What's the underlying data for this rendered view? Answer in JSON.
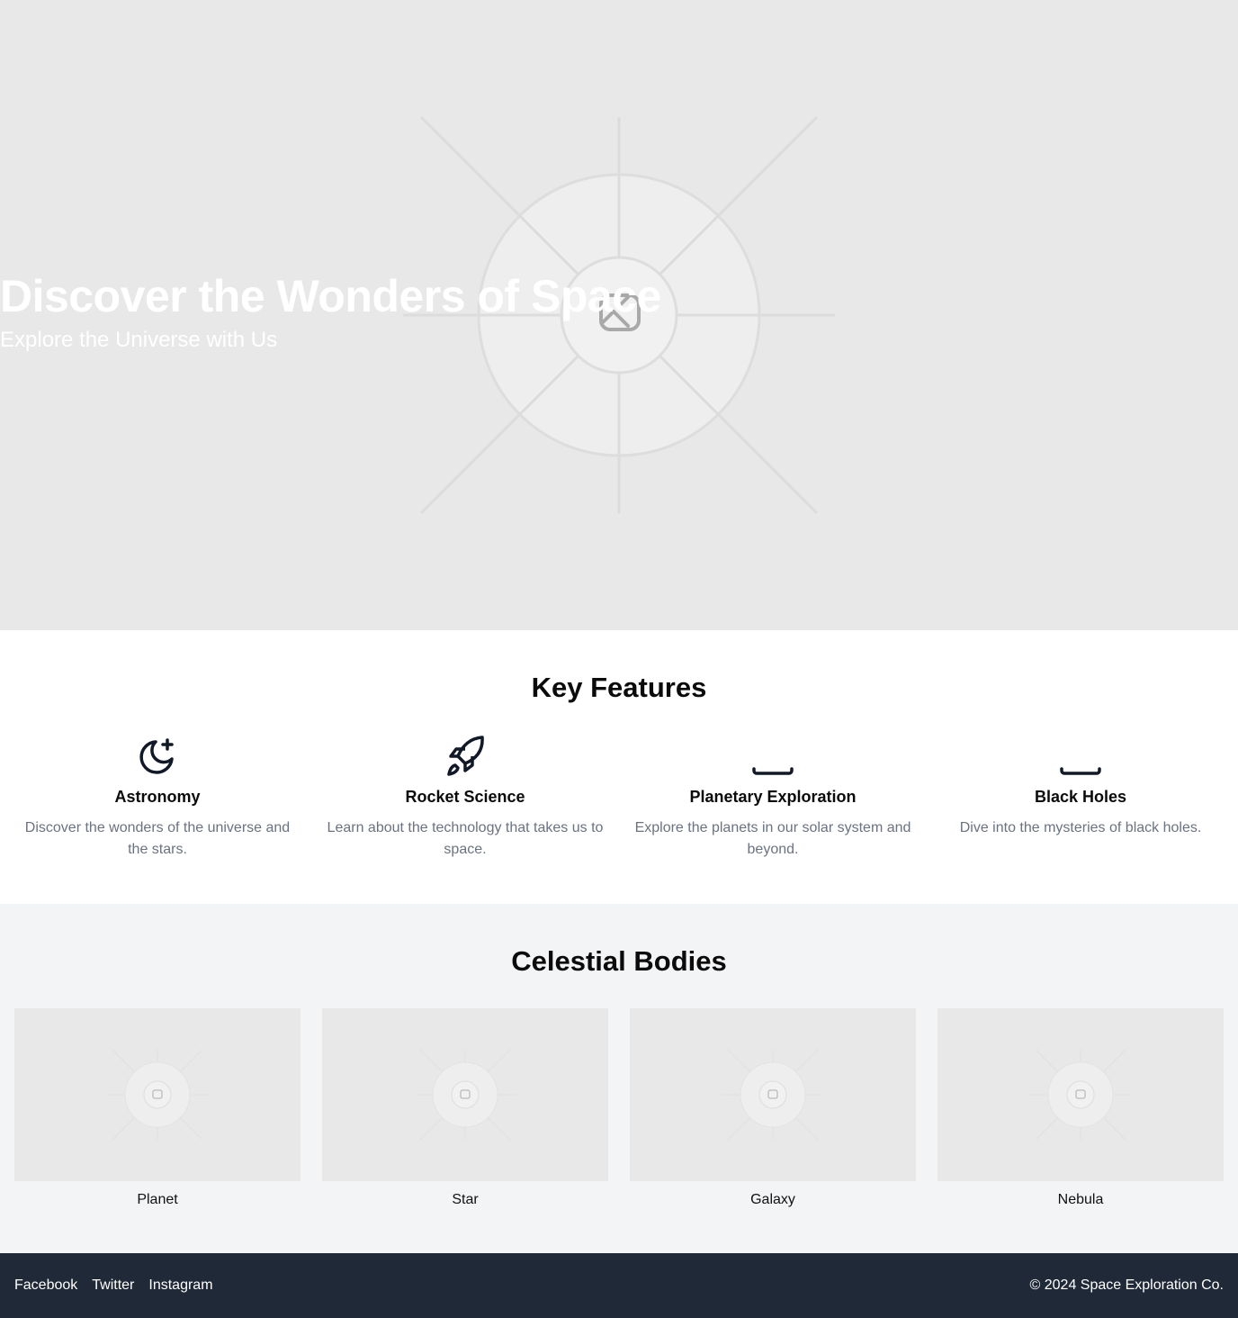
{
  "hero": {
    "title": "Discover the Wonders of Space",
    "subtitle": "Explore the Universe with Us",
    "background_color": "#e8e8e8",
    "image_icon": "image-placeholder-icon"
  },
  "features": {
    "title": "Key Features",
    "items": [
      {
        "icon": "moon-star-icon",
        "title": "Astronomy",
        "description": "Discover the wonders of the universe and the stars."
      },
      {
        "icon": "rocket-icon",
        "title": "Rocket Science",
        "description": "Learn about the technology that takes us to space."
      },
      {
        "icon": "planet-icon",
        "title": "Planetary Exploration",
        "description": "Explore the planets in our solar system and beyond."
      },
      {
        "icon": "black-hole-icon",
        "title": "Black Holes",
        "description": "Dive into the mysteries of black holes."
      }
    ]
  },
  "celestial": {
    "title": "Celestial Bodies",
    "items": [
      {
        "label": "Planet",
        "image_icon": "image-placeholder-icon"
      },
      {
        "label": "Star",
        "image_icon": "image-placeholder-icon"
      },
      {
        "label": "Galaxy",
        "image_icon": "image-placeholder-icon"
      },
      {
        "label": "Nebula",
        "image_icon": "image-placeholder-icon"
      }
    ]
  },
  "footer": {
    "links": [
      "Facebook",
      "Twitter",
      "Instagram"
    ],
    "copyright": "© 2024 Space Exploration Co.",
    "background_color": "#1f2937"
  },
  "colors": {
    "text_dark": "#0b0b0b",
    "text_muted": "#6b7280",
    "section_alt_bg": "#f3f4f6",
    "placeholder_bg": "#e8e8e8"
  }
}
